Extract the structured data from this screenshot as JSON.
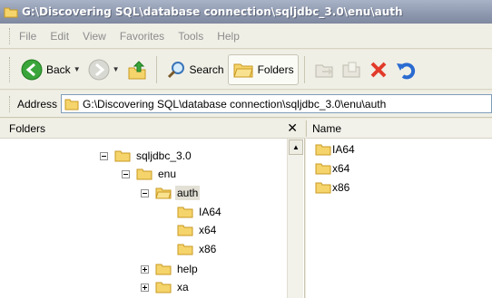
{
  "window": {
    "title": "G:\\Discovering SQL\\database connection\\sqljdbc_3.0\\enu\\auth"
  },
  "menu": {
    "items": [
      {
        "label": "File",
        "key": "F"
      },
      {
        "label": "Edit",
        "key": "E"
      },
      {
        "label": "View",
        "key": "V"
      },
      {
        "label": "Favorites",
        "key": "a"
      },
      {
        "label": "Tools",
        "key": "T"
      },
      {
        "label": "Help",
        "key": "H"
      }
    ]
  },
  "toolbar": {
    "back_label": "Back",
    "search_label": "Search",
    "folders_label": "Folders"
  },
  "address": {
    "label": "Address",
    "value": "G:\\Discovering SQL\\database connection\\sqljdbc_3.0\\enu\\auth"
  },
  "folders_pane": {
    "title": "Folders",
    "close_glyph": "✕",
    "tree": [
      {
        "label": "sqljdbc_3.0",
        "expander": "minus",
        "selected": false
      },
      {
        "label": "enu",
        "expander": "minus",
        "selected": false
      },
      {
        "label": "auth",
        "expander": "minus",
        "selected": true
      },
      {
        "label": "IA64",
        "expander": "none",
        "selected": false
      },
      {
        "label": "x64",
        "expander": "none",
        "selected": false
      },
      {
        "label": "x86",
        "expander": "none",
        "selected": false
      },
      {
        "label": "help",
        "expander": "plus",
        "selected": false
      },
      {
        "label": "xa",
        "expander": "plus",
        "selected": false
      }
    ]
  },
  "content_pane": {
    "column_name": "Name",
    "items": [
      {
        "label": "IA64"
      },
      {
        "label": "x64"
      },
      {
        "label": "x86"
      }
    ]
  },
  "colors": {
    "folder_fill": "#f5d46b",
    "folder_stroke": "#c99a22",
    "back_green": "#3aa53a",
    "delete_red": "#e23b2a",
    "undo_blue": "#2a6bd1"
  }
}
